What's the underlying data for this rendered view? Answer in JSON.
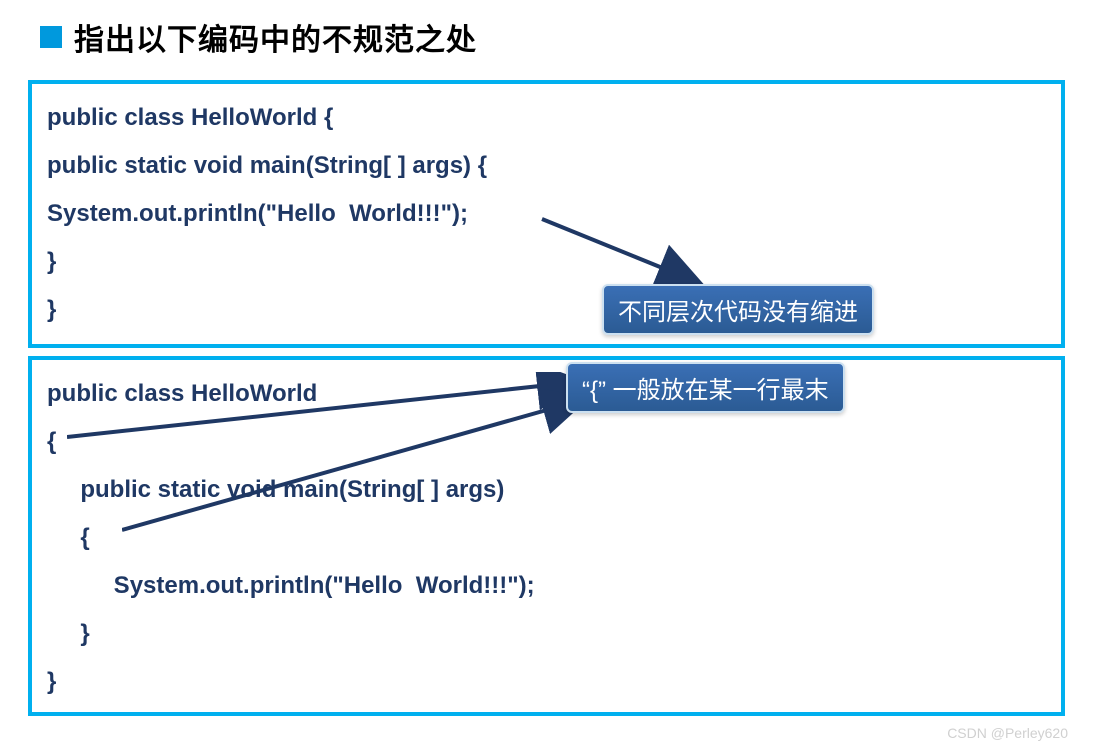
{
  "header": {
    "title": "指出以下编码中的不规范之处"
  },
  "code_block_1": {
    "lines": [
      "public class HelloWorld {",
      "public static void main(String[ ] args) {",
      "System.out.println(\"Hello  World!!!\");",
      "}",
      "}"
    ],
    "annotation": "不同层次代码没有缩进"
  },
  "code_block_2": {
    "lines": [
      "public class HelloWorld",
      "{",
      "     public static void main(String[ ] args)",
      "     {",
      "          System.out.println(\"Hello  World!!!\");",
      "     }",
      "}"
    ],
    "annotation": "“{” 一般放在某一行最末"
  },
  "watermark": "CSDN @Perley620"
}
